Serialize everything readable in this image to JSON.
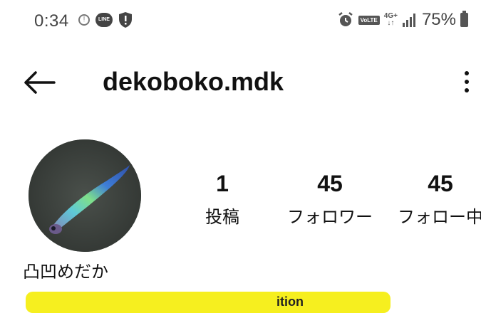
{
  "status_bar": {
    "time": "0:34",
    "line_label": "LINE",
    "volte_label": "VoLTE",
    "network_label": "4G+",
    "battery_text": "75%"
  },
  "header": {
    "username": "dekoboko.mdk"
  },
  "profile": {
    "display_name": "凸凹めだか",
    "bio_partial": "ition"
  },
  "stats": {
    "posts": {
      "count": "1",
      "label": "投稿"
    },
    "followers": {
      "count": "45",
      "label": "フォロワー"
    },
    "following": {
      "count": "45",
      "label": "フォロー中"
    }
  },
  "colors": {
    "text": "#111111",
    "highlight": "#f6ef1f",
    "status_gray": "#444444"
  },
  "icons": [
    "back-arrow-icon",
    "more-vertical-icon",
    "alarm-icon",
    "signal-icon",
    "battery-icon",
    "line-app-icon",
    "shield-icon",
    "info-circle-icon"
  ]
}
